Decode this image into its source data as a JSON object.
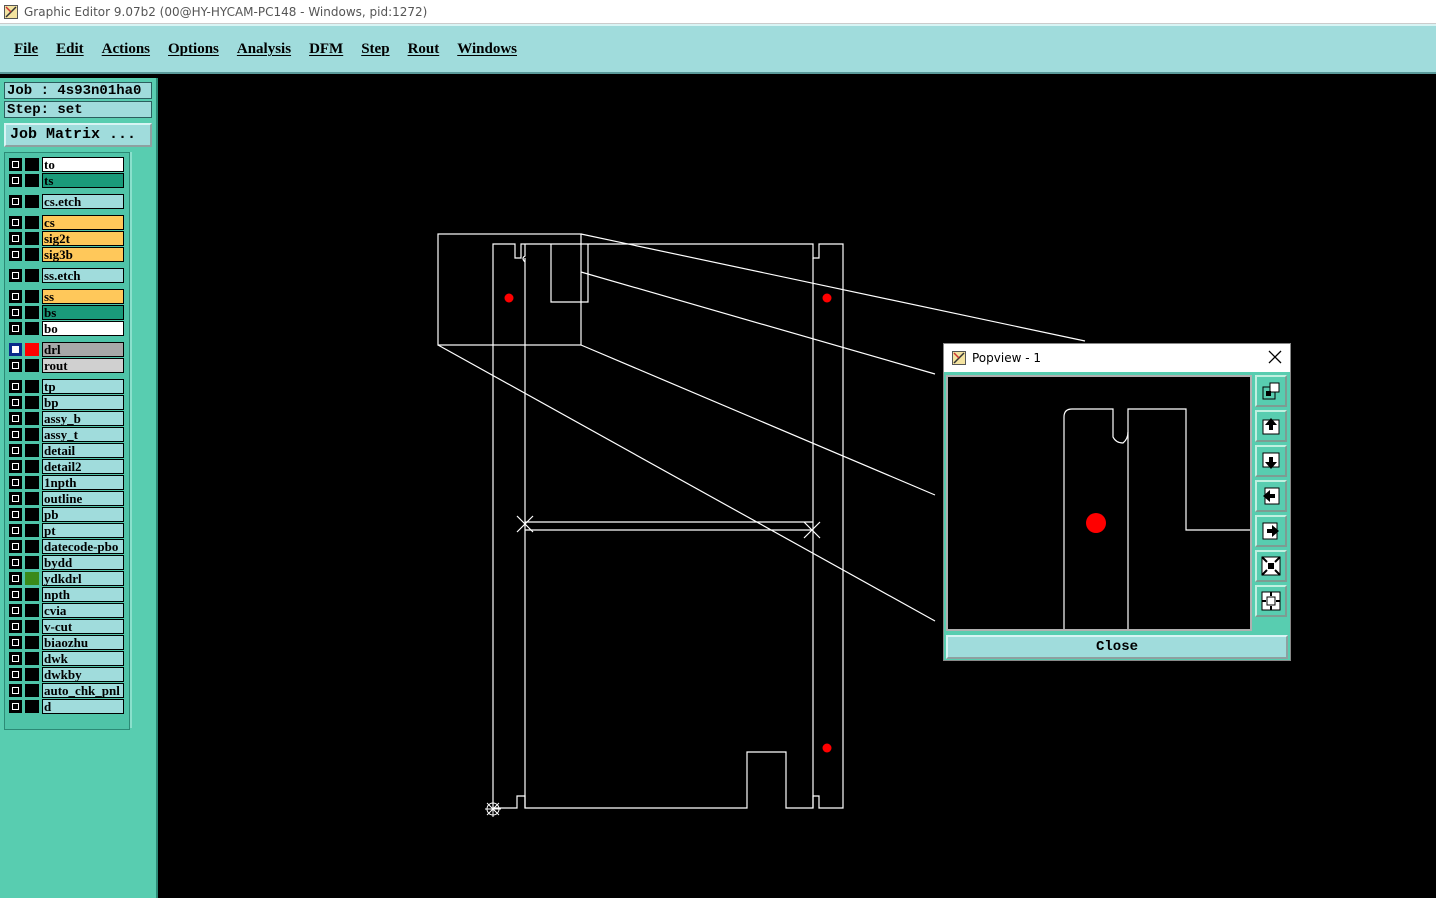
{
  "window": {
    "title": "Graphic Editor 9.07b2 (00@HY-HYCAM-PC148 - Windows, pid:1272)"
  },
  "menu": [
    "File",
    "Edit",
    "Actions",
    "Options",
    "Analysis",
    "DFM",
    "Step",
    "Rout",
    "Windows"
  ],
  "job": {
    "job_label": "Job : 4s93n01ha0",
    "step_label": "Step: set",
    "matrix_button": "Job Matrix ..."
  },
  "layers": [
    {
      "name": "to",
      "color": "#ffffff"
    },
    {
      "name": "ts",
      "color": "#1a9a7a"
    },
    {
      "name": "cs.etch",
      "color": "#a0dcdc"
    },
    {
      "name": "cs",
      "color": "#ffc85a"
    },
    {
      "name": "sig2t",
      "color": "#ffc85a"
    },
    {
      "name": "sig3b",
      "color": "#ffc85a"
    },
    {
      "name": "ss.etch",
      "color": "#a0dcdc"
    },
    {
      "name": "ss",
      "color": "#ffc85a"
    },
    {
      "name": "bs",
      "color": "#1a9a7a"
    },
    {
      "name": "bo",
      "color": "#ffffff"
    },
    {
      "name": "drl",
      "color": "#a8a8a8",
      "active": true,
      "display_color": "#ff0000"
    },
    {
      "name": "rout",
      "color": "#d0d0d0"
    },
    {
      "name": "tp",
      "color": "#a0dcdc"
    },
    {
      "name": "bp",
      "color": "#a0dcdc"
    },
    {
      "name": "assy_b",
      "color": "#a0dcdc"
    },
    {
      "name": "assy_t",
      "color": "#a0dcdc"
    },
    {
      "name": "detail",
      "color": "#a0dcdc"
    },
    {
      "name": "detail2",
      "color": "#a0dcdc"
    },
    {
      "name": "1npth",
      "color": "#a0dcdc"
    },
    {
      "name": "outline",
      "color": "#a0dcdc"
    },
    {
      "name": "pb",
      "color": "#a0dcdc"
    },
    {
      "name": "pt",
      "color": "#a0dcdc"
    },
    {
      "name": "datecode-pbo",
      "color": "#a0dcdc"
    },
    {
      "name": "bydd",
      "color": "#a0dcdc"
    },
    {
      "name": "ydkdrl",
      "color": "#a0dcdc",
      "display_color": "#3a8a1a"
    },
    {
      "name": "npth",
      "color": "#a0dcdc"
    },
    {
      "name": "cvia",
      "color": "#a0dcdc"
    },
    {
      "name": "v-cut",
      "color": "#a0dcdc"
    },
    {
      "name": "biaozhu",
      "color": "#a0dcdc"
    },
    {
      "name": "dwk",
      "color": "#a0dcdc"
    },
    {
      "name": "dwkby",
      "color": "#a0dcdc"
    },
    {
      "name": "auto_chk_pnl",
      "color": "#a0dcdc"
    },
    {
      "name": "d",
      "color": "#a0dcdc"
    }
  ],
  "popview": {
    "title": "Popview - 1",
    "close_label": "Close",
    "tools": [
      "zoom-home-icon",
      "pan-up-icon",
      "pan-down-icon",
      "pan-left-icon",
      "pan-right-icon",
      "zoom-in-icon",
      "zoom-out-icon"
    ]
  },
  "colors": {
    "menubar": "#a0dcdc",
    "panel": "#58cdb0",
    "canvas": "#000000",
    "drill_pad": "#ff0000"
  }
}
